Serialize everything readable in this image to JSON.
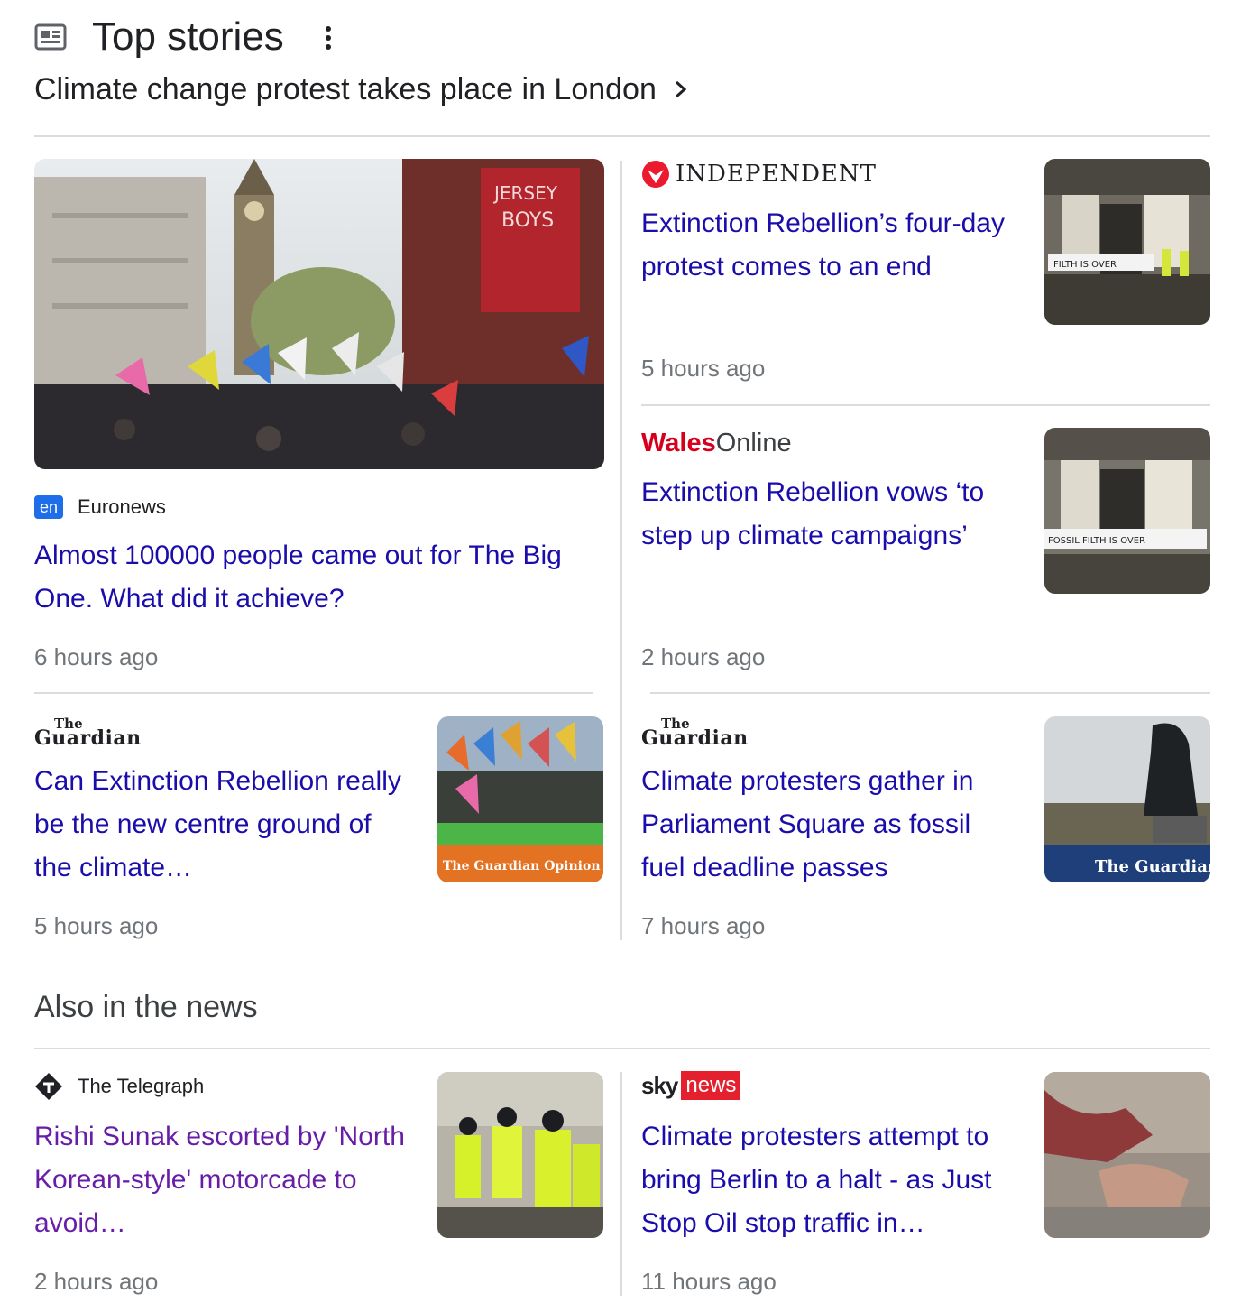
{
  "header": {
    "title": "Top stories",
    "icon": "newspaper-icon",
    "menu_icon": "more-vert-icon",
    "subtitle": "Climate change protest takes place in London"
  },
  "stories": {
    "featured": {
      "source": "Euronews",
      "source_badge": "en",
      "headline": "Almost 100000 people came out for The Big One. What did it achieve?",
      "time": "6 hours ago"
    },
    "independent": {
      "source": "INDEPENDENT",
      "headline": "Extinction Rebellion’s four-day protest comes to an end",
      "time": "5 hours ago",
      "thumb_text": "FILTH IS OVER"
    },
    "walesonline": {
      "source_bold": "Wales",
      "source_light": "Online",
      "headline": "Extinction Rebellion vows ‘to step up climate campaigns’",
      "time": "2 hours ago",
      "thumb_text": "FOSSIL FILTH IS OVER"
    },
    "guardian_left": {
      "source_the": "The",
      "source_name": "Guardian",
      "headline": "Can Extinction Rebellion really be the new centre ground of the climate…",
      "time": "5 hours ago",
      "thumb_text": "The Guardian Opinion"
    },
    "guardian_right": {
      "source_the": "The",
      "source_name": "Guardian",
      "headline": "Climate protesters gather in Parliament Square as fossil fuel deadline passes",
      "time": "7 hours ago",
      "thumb_text": "The Guardian"
    }
  },
  "also_in_news": {
    "title": "Also in the news",
    "telegraph": {
      "source": "The Telegraph",
      "headline": "Rishi Sunak escorted by 'North Korean-style' motorcade to avoid…",
      "time": "2 hours ago"
    },
    "skynews": {
      "source_sky": "sky",
      "source_news": "news",
      "headline": "Climate protesters attempt to bring Berlin to a halt - as Just Stop Oil stop traffic in…",
      "time": "11 hours ago"
    }
  },
  "colors": {
    "link": "#1a0dab",
    "visited": "#681da8",
    "muted": "#70757a",
    "divider": "#dadce0",
    "independent_red": "#ec1a2e",
    "wales_red": "#d6001c",
    "sky_red": "#e4202e",
    "euronews_blue": "#1d6ee8"
  }
}
